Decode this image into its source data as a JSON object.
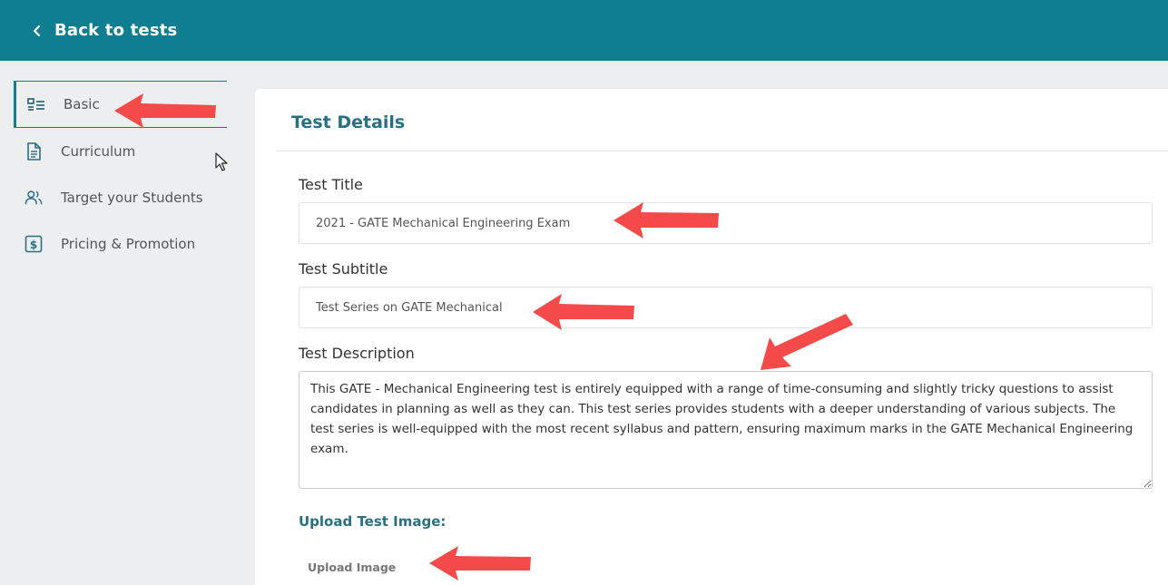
{
  "topbar": {
    "back_label": "Back to tests",
    "color": "#107e91"
  },
  "sidebar": {
    "items": [
      {
        "label": "Basic",
        "icon": "basic-info-icon",
        "active": true
      },
      {
        "label": "Curriculum",
        "icon": "document-icon",
        "active": false
      },
      {
        "label": "Target your Students",
        "icon": "users-icon",
        "active": false
      },
      {
        "label": "Pricing & Promotion",
        "icon": "dollar-icon",
        "active": false
      }
    ]
  },
  "main": {
    "title": "Test Details",
    "test_title": {
      "label": "Test Title",
      "value": "2021 - GATE Mechanical Engineering Exam"
    },
    "test_subtitle": {
      "label": "Test Subtitle",
      "value": "Test Series on GATE Mechanical"
    },
    "test_description": {
      "label": "Test Description",
      "value": "This GATE - Mechanical Engineering test is entirely equipped with a range of time-consuming and slightly tricky questions to assist candidates in planning as well as they can. This test series provides students with a deeper understanding of various subjects. The test series is well-equipped with the most recent syllabus and pattern, ensuring maximum marks in the GATE Mechanical Engineering exam."
    },
    "upload": {
      "heading": "Upload Test Image:",
      "button_label": "Upload Image"
    }
  },
  "annotation_color": "#f44a4a"
}
